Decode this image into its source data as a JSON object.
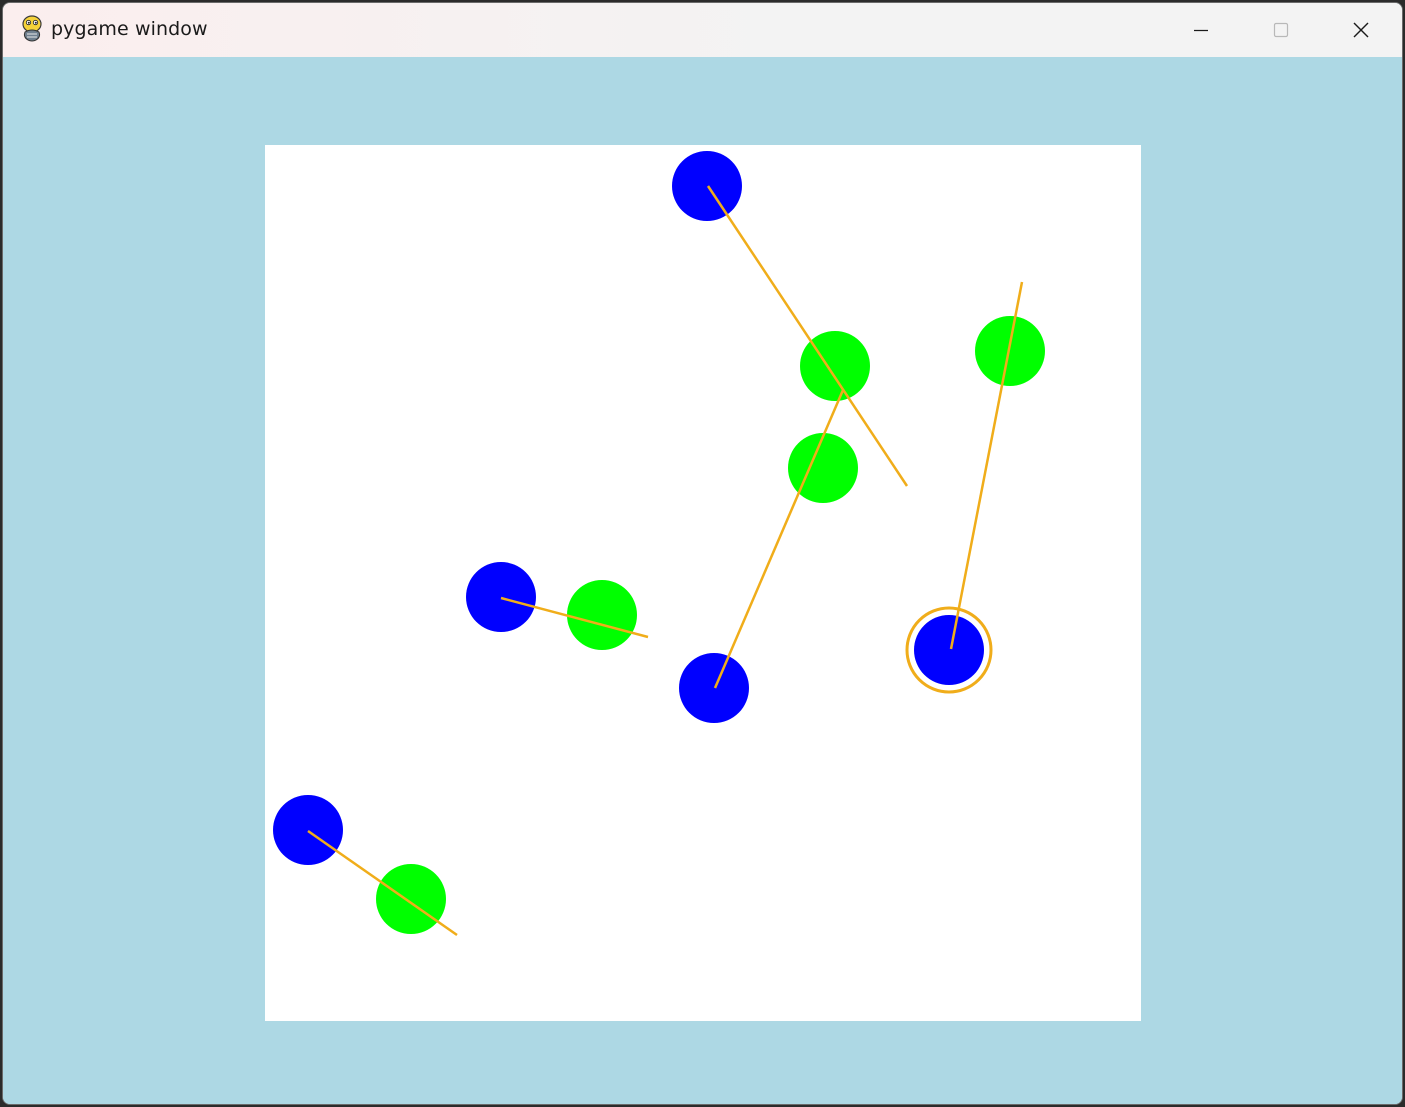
{
  "window": {
    "title": "pygame window",
    "icon": "pygame-snake-icon"
  },
  "controls": {
    "minimize_icon": "minimize-icon",
    "maximize_icon": "maximize-icon",
    "close_icon": "close-icon"
  },
  "colors": {
    "client_background": "#add8e4",
    "board_background": "#ffffff",
    "blue_ball": "#0000ff",
    "green_ball": "#00ff00",
    "line": "#f0ad1a",
    "selection_ring": "#f0ad1a"
  }
}
